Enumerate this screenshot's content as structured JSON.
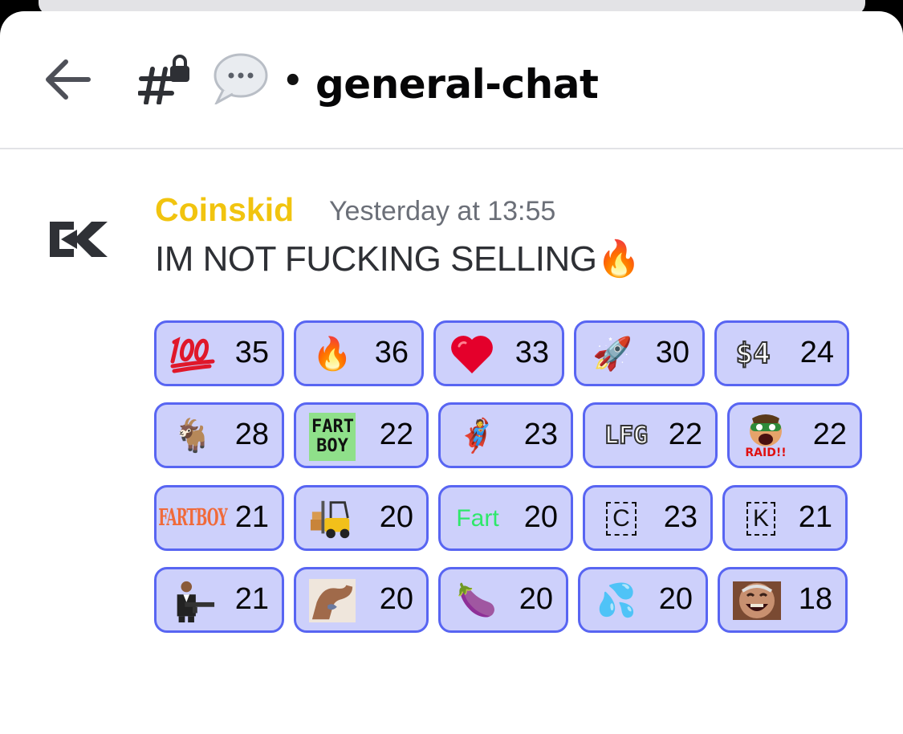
{
  "header": {
    "channel_name": "general-chat",
    "separator": "•"
  },
  "message": {
    "username": "Coinskid",
    "timestamp": "Yesterday at 13:55",
    "text": "IM NOT FUCKING SELLING",
    "text_emoji": "🔥"
  },
  "colors": {
    "username": "#f1c40f",
    "reaction_bg": "#cdd0fb",
    "reaction_border": "#5865f2"
  },
  "reactions": [
    {
      "icon": "hundred-points-icon",
      "glyph": "💯",
      "count": "35"
    },
    {
      "icon": "fire-icon",
      "glyph": "🔥",
      "count": "36"
    },
    {
      "icon": "red-heart-icon",
      "glyph": "❤️",
      "count": "33"
    },
    {
      "icon": "rocket-icon",
      "glyph": "🚀",
      "count": "30"
    },
    {
      "icon": "dollar-4-icon",
      "glyph": "$4",
      "count": "24"
    },
    {
      "icon": "goat-icon",
      "glyph": "🐐",
      "count": "28"
    },
    {
      "icon": "fart-boy-sticker-icon",
      "glyph": "FART BOY",
      "count": "22"
    },
    {
      "icon": "superhero-kid-icon",
      "glyph": "🦸",
      "count": "23"
    },
    {
      "icon": "lfg-icon",
      "glyph": "LFG",
      "count": "22"
    },
    {
      "icon": "raid-face-icon",
      "glyph": "RAID!!",
      "count": "22"
    },
    {
      "icon": "fartboy-text-icon",
      "glyph": "FARTBOY",
      "count": "21"
    },
    {
      "icon": "forklift-icon",
      "glyph": "🏗",
      "count": "20"
    },
    {
      "icon": "fart-text-icon",
      "glyph": "Fart",
      "count": "20"
    },
    {
      "icon": "letter-c-icon",
      "glyph": "C",
      "count": "23"
    },
    {
      "icon": "letter-k-icon",
      "glyph": "K",
      "count": "21"
    },
    {
      "icon": "gunman-icon",
      "glyph": "🔫",
      "count": "21"
    },
    {
      "icon": "flexed-arm-icon",
      "glyph": "💪",
      "count": "20"
    },
    {
      "icon": "eggplant-icon",
      "glyph": "🍆",
      "count": "20"
    },
    {
      "icon": "sweat-droplets-icon",
      "glyph": "💦",
      "count": "20"
    },
    {
      "icon": "laughing-man-icon",
      "glyph": "😄",
      "count": "18"
    }
  ]
}
